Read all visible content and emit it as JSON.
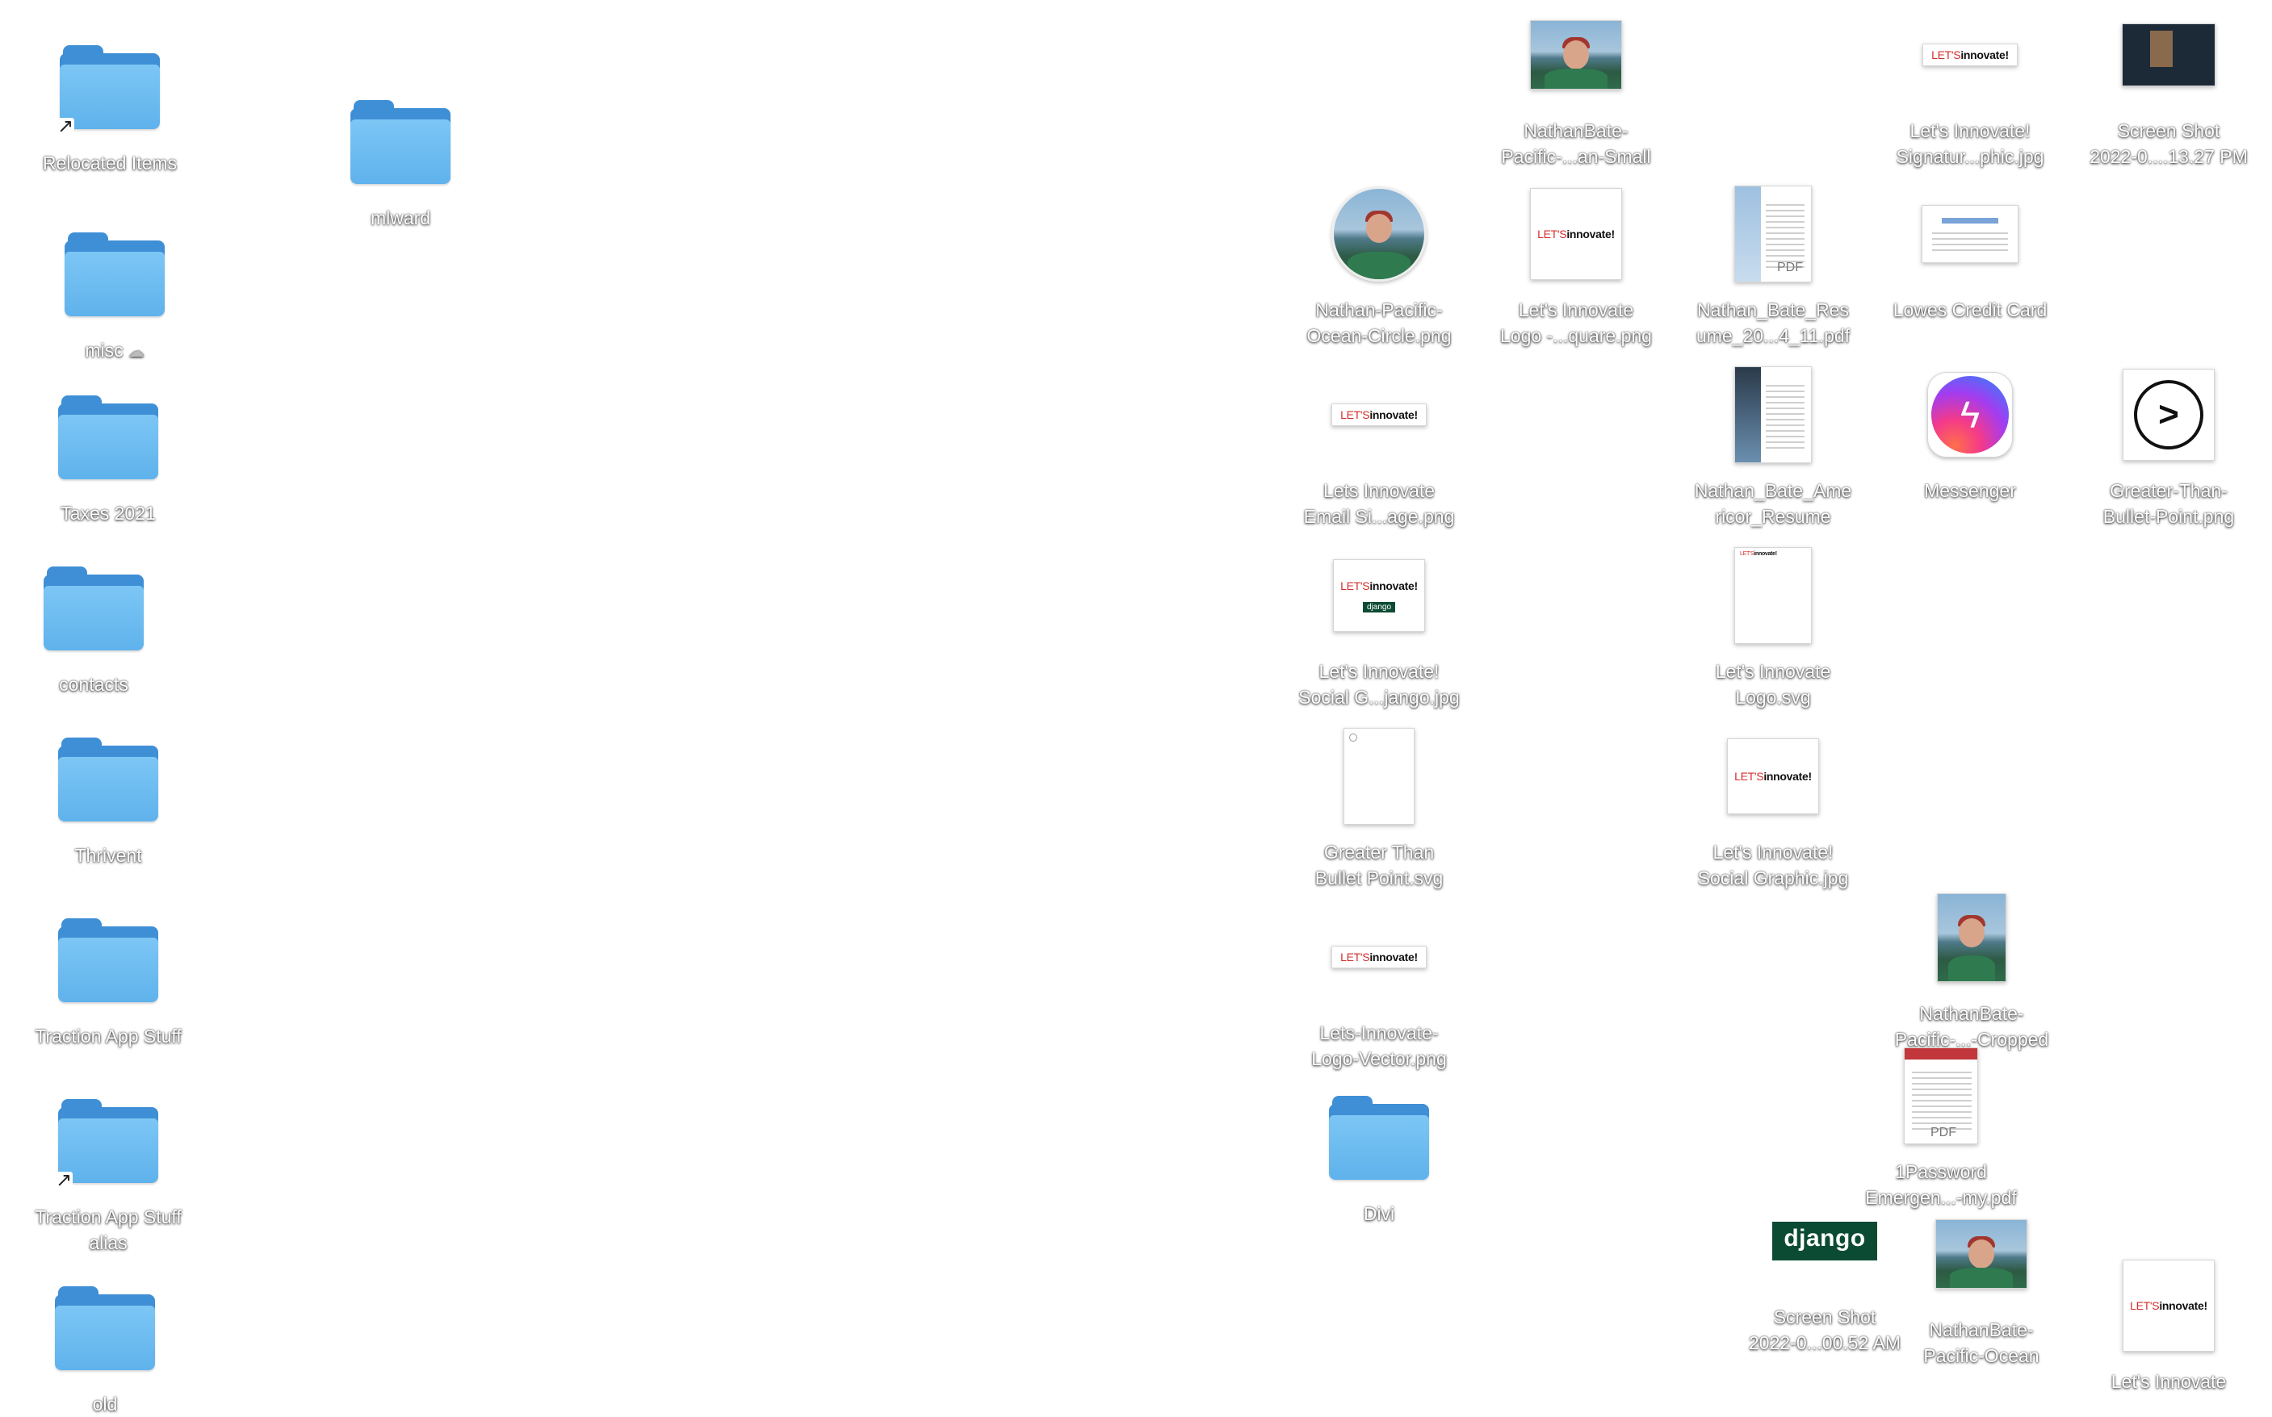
{
  "desktop": {
    "items": [
      {
        "label": "Relocated Items",
        "type": "folder-alias"
      },
      {
        "label": "mlward",
        "type": "folder"
      },
      {
        "label": "misc",
        "type": "folder",
        "badge": "cloud"
      },
      {
        "label": "Taxes 2021",
        "type": "folder"
      },
      {
        "label": "contacts",
        "type": "folder"
      },
      {
        "label": "Thrivent",
        "type": "folder"
      },
      {
        "label": "Traction App Stuff",
        "type": "folder"
      },
      {
        "label": [
          "Traction App Stuff",
          "alias"
        ],
        "type": "folder-alias"
      },
      {
        "label": "old",
        "type": "folder"
      },
      {
        "label": [
          "NathanBate-",
          "Pacific-...an-Small"
        ],
        "type": "photo"
      },
      {
        "label": [
          "Let's Innovate!",
          "Signatur...phic.jpg"
        ],
        "type": "brand-strip"
      },
      {
        "label": [
          "Screen Shot",
          "2022-0....13.27 PM"
        ],
        "type": "screenshot"
      },
      {
        "label": [
          "Nathan-Pacific-",
          "Ocean-Circle.png"
        ],
        "type": "circle-photo"
      },
      {
        "label": [
          "Let's Innovate",
          "Logo -...quare.png"
        ],
        "type": "brand-square"
      },
      {
        "label": [
          "Nathan_Bate_Res",
          "ume_20...4_11.pdf"
        ],
        "type": "pdf"
      },
      {
        "label": "Lowes Credit Card",
        "type": "card-image"
      },
      {
        "label": [
          "Lets Innovate",
          "Email Si...age.png"
        ],
        "type": "brand-strip"
      },
      {
        "label": [
          "Nathan_Bate_Ame",
          "ricor_Resume"
        ],
        "type": "pdf-dark"
      },
      {
        "label": "Messenger",
        "type": "messenger-app"
      },
      {
        "label": [
          "Greater-Than-",
          "Bullet-Point.png"
        ],
        "type": "greater-than"
      },
      {
        "label": [
          "Let's Innovate!",
          "Social G...jango.jpg"
        ],
        "type": "brand-social"
      },
      {
        "label": [
          "Let's Innovate",
          "Logo.svg"
        ],
        "type": "svg-page"
      },
      {
        "label": [
          "Greater Than",
          "Bullet Point.svg"
        ],
        "type": "svg-blank"
      },
      {
        "label": [
          "Let's Innovate!",
          "Social Graphic.jpg"
        ],
        "type": "brand-square"
      },
      {
        "label": [
          "Lets-Innovate-",
          "Logo-Vector.png"
        ],
        "type": "brand-strip"
      },
      {
        "label": [
          "NathanBate-",
          "Pacific-...-Cropped"
        ],
        "type": "photo-portrait"
      },
      {
        "label": [
          "1Password",
          "Emergen...-my.pdf"
        ],
        "type": "pdf-red"
      },
      {
        "label": "Divi",
        "type": "folder"
      },
      {
        "label": [
          "Screen Shot",
          "2022-0...00.52 AM"
        ],
        "type": "django-screenshot"
      },
      {
        "label": [
          "NathanBate-",
          "Pacific-Ocean"
        ],
        "type": "photo"
      },
      {
        "label": [
          "Let's Innovate",
          ""
        ],
        "type": "brand-square"
      }
    ]
  },
  "brand": {
    "lets": "LET'S",
    "innovate": "innovate!",
    "django": "django",
    "pdf": "PDF"
  },
  "glyphs": {
    "alias_arrow": "↗",
    "cloud": "☁",
    "messenger_bolt": "ϟ",
    "greater_than": ">"
  }
}
